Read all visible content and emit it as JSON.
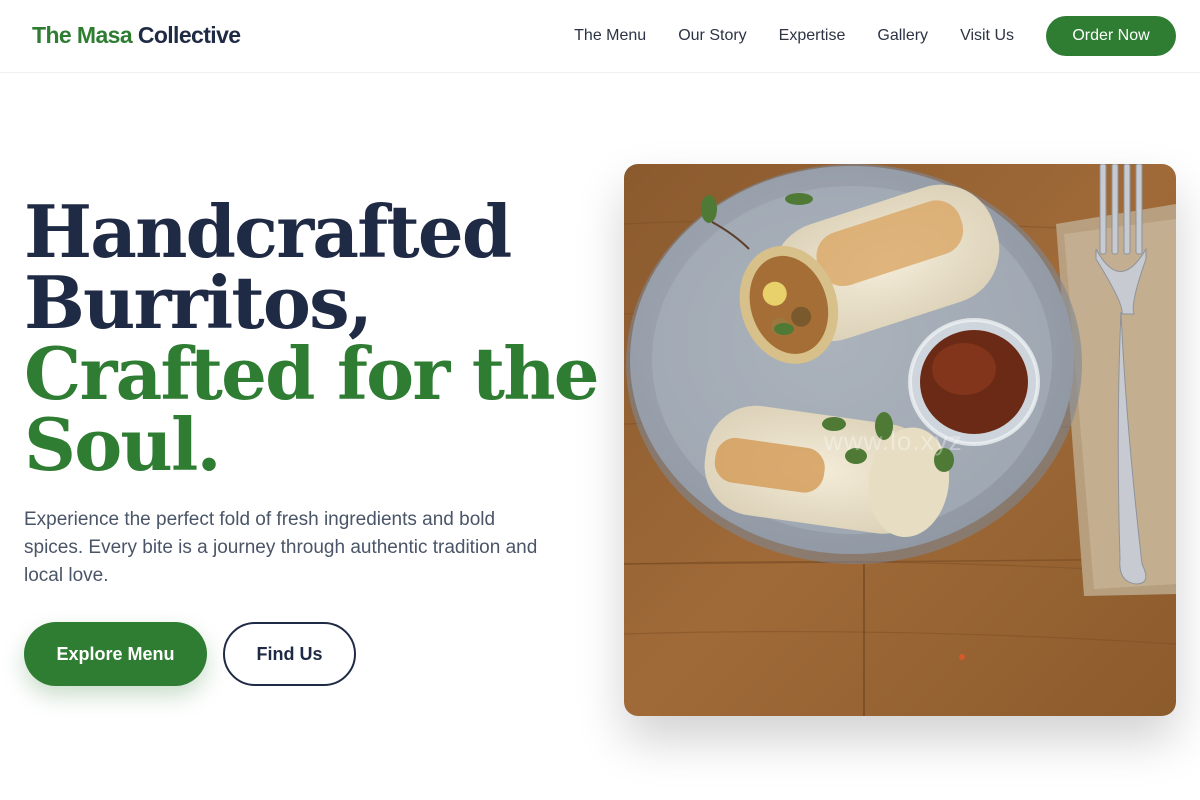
{
  "brand": {
    "name_part1": "The Masa",
    "name_part2": "Collective",
    "accent_color": "#2e7d32",
    "dark_color": "#1f2a44"
  },
  "nav": {
    "items": [
      {
        "label": "The Menu"
      },
      {
        "label": "Our Story"
      },
      {
        "label": "Expertise"
      },
      {
        "label": "Gallery"
      },
      {
        "label": "Visit Us"
      }
    ],
    "cta_label": "Order Now"
  },
  "hero": {
    "headline_lines": [
      {
        "text": "Handcrafted",
        "color": "dark"
      },
      {
        "text": "Burritos,",
        "color": "dark"
      },
      {
        "text": "Crafted for the",
        "color": "green"
      },
      {
        "text": "Soul.",
        "color": "green"
      }
    ],
    "subtext": "Experience the perfect fold of fresh ingredients and bold spices. Every bite is a journey through authentic tradition and local love.",
    "primary_button": "Explore Menu",
    "secondary_button": "Find Us",
    "image": {
      "subject": "burrito halves on a plate with salsa cup and fork on wooden table",
      "watermark": "www.lo.xyz"
    }
  }
}
